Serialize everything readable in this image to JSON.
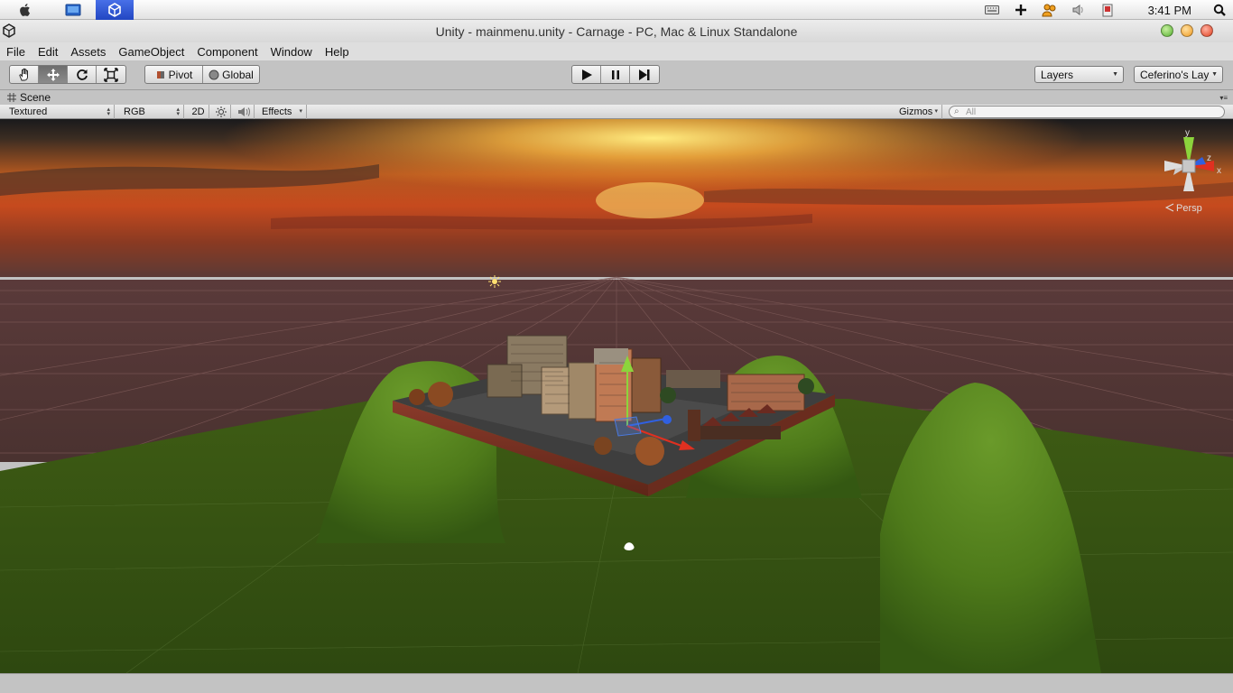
{
  "os": {
    "clock": "3:41 PM",
    "launchers": [
      "apple-icon",
      "desktop-icon",
      "unity-icon"
    ],
    "tray_icons": [
      "keyboard-icon",
      "plus-icon",
      "people-icon",
      "volume-icon",
      "battery-icon",
      "search-icon"
    ]
  },
  "window": {
    "title": "Unity - mainmenu.unity - Carnage - PC, Mac & Linux Standalone"
  },
  "menu": [
    "File",
    "Edit",
    "Assets",
    "GameObject",
    "Component",
    "Window",
    "Help"
  ],
  "toolbar": {
    "tools": [
      "hand-tool-icon",
      "move-tool-icon",
      "rotate-tool-icon",
      "scale-tool-icon"
    ],
    "active_tool": "move-tool-icon",
    "pivot_label": "Pivot",
    "global_label": "Global",
    "play_controls": [
      "play-icon",
      "pause-icon",
      "step-icon"
    ],
    "layers_label": "Layers",
    "layout_label": "Ceferino's Lay"
  },
  "scene": {
    "tab_label": "Scene",
    "draw_mode": "Textured",
    "render_mode": "RGB",
    "twod_label": "2D",
    "effects_label": "Effects",
    "gizmos_label": "Gizmos",
    "search_placeholder": "All",
    "persp_label": "Persp",
    "axis_labels": {
      "y": "y",
      "z": "z",
      "x": "x"
    }
  },
  "colors": {
    "unity_blue": "#2246c2",
    "sky_top": "#1a1a1c",
    "sun": "#ffe070",
    "grass": "#3c5a18",
    "gizmo_y": "#8cd43c",
    "gizmo_x": "#e03020",
    "gizmo_z": "#3060e0"
  }
}
